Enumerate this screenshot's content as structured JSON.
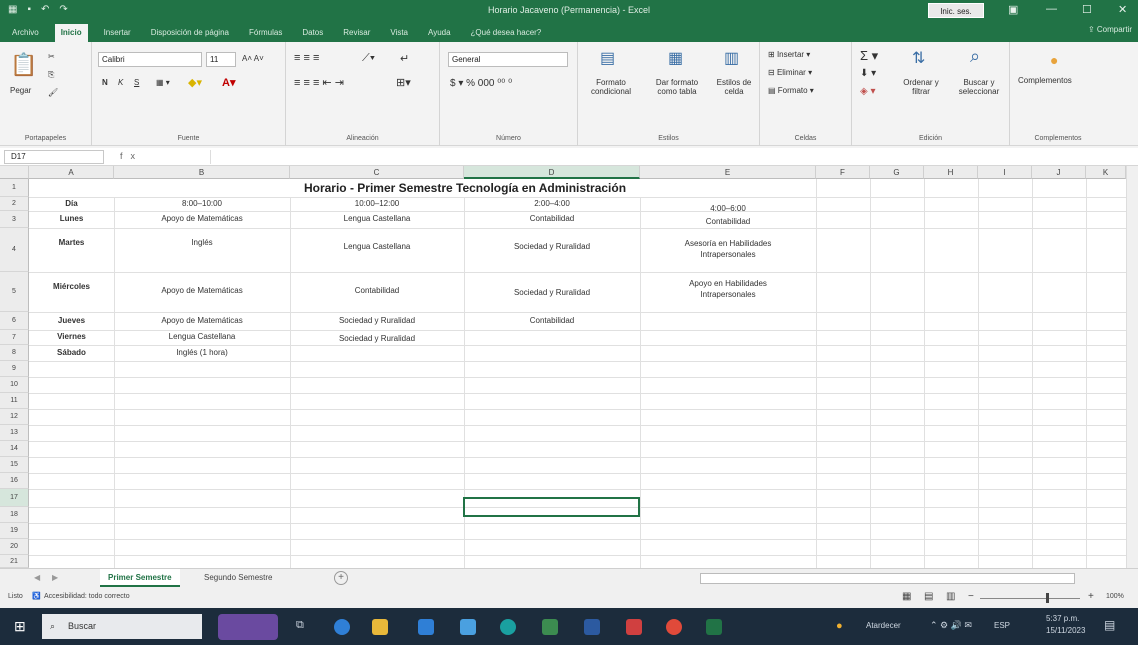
{
  "window": {
    "title": "Horario Jacaveno (Permanencia) - Excel",
    "signin": "Inic. ses."
  },
  "ribbon": {
    "tabs": [
      "Archivo",
      "Inicio",
      "Insertar",
      "Disposición de página",
      "Fórmulas",
      "Datos",
      "Revisar",
      "Vista",
      "Ayuda",
      "¿Qué desea hacer?"
    ],
    "share": "Compartir",
    "clipboard": {
      "paste": "Pegar",
      "label": "Portapapeles"
    },
    "font": {
      "name": "Calibri",
      "size": "11",
      "bold": "N",
      "italic": "K",
      "underline": "S",
      "label": "Fuente"
    },
    "alignment": {
      "label": "Alineación"
    },
    "number": {
      "format": "General",
      "label": "Número"
    },
    "styles": {
      "conditional": "Formato condicional",
      "table": "Dar formato como tabla",
      "cell": "Estilos de celda",
      "label": "Estilos"
    },
    "cells": {
      "insert": "Insertar",
      "delete": "Eliminar",
      "format": "Formato",
      "label": "Celdas"
    },
    "editing": {
      "sort": "Ordenar y filtrar",
      "find": "Buscar y seleccionar",
      "label": "Edición"
    },
    "addins": {
      "button": "Complementos",
      "label": "Complementos"
    }
  },
  "formula_bar": {
    "namebox": "D17",
    "fx": "fx",
    "value": ""
  },
  "grid": {
    "columns": [
      "A",
      "B",
      "C",
      "D",
      "E",
      "F",
      "G",
      "H",
      "I",
      "J",
      "K"
    ],
    "selected_column": "D",
    "rows": [
      "1",
      "2",
      "3",
      "4",
      "5",
      "6",
      "7",
      "8",
      "9",
      "10",
      "11",
      "12",
      "13",
      "14",
      "15",
      "16",
      "17",
      "18",
      "19",
      "20",
      "21"
    ],
    "selected_row": "17",
    "title": "Horario - Primer Semestre Tecnología en Administración",
    "header": {
      "day": "Día",
      "b": "8:00–10:00",
      "c": "10:00–12:00",
      "d": "2:00–4:00",
      "e": "4:00–6:00"
    },
    "schedule": [
      {
        "day": "Lunes",
        "b": "Apoyo de Matemáticas",
        "c": "Lengua Castellana",
        "d": "Contabilidad",
        "e": "Contabilidad"
      },
      {
        "day": "Martes",
        "b": "Inglés",
        "c": "Lengua Castellana",
        "d": "Sociedad y Ruralidad",
        "e": "Asesoría en Habilidades Intrapersonales"
      },
      {
        "day": "Miércoles",
        "b": "Apoyo de Matemáticas",
        "c": "Contabilidad",
        "d": "Sociedad y Ruralidad",
        "e": "Apoyo en Habilidades Intrapersonales"
      },
      {
        "day": "Jueves",
        "b": "Apoyo de Matemáticas",
        "c": "Sociedad y Ruralidad",
        "d": "Contabilidad",
        "e": ""
      },
      {
        "day": "Viernes",
        "b": "Lengua Castellana",
        "c": "Sociedad y Ruralidad",
        "d": "",
        "e": ""
      },
      {
        "day": "Sábado",
        "b": "Inglés (1 hora)",
        "c": "",
        "d": "",
        "e": ""
      }
    ]
  },
  "sheets": {
    "tabs": [
      "Primer Semestre",
      "Segundo Semestre"
    ],
    "active": "Primer Semestre"
  },
  "status": {
    "ready": "Listo",
    "accessibility": "Accesibilidad: todo correcto",
    "zoom": "100%"
  },
  "taskbar": {
    "search": "Buscar",
    "weather": "Atardecer",
    "lang": "ESP",
    "time": "5:37 p.m.",
    "date": "15/11/2023"
  },
  "colors": {
    "excel_green": "#217346",
    "taskbar": "#1c2c3c"
  }
}
